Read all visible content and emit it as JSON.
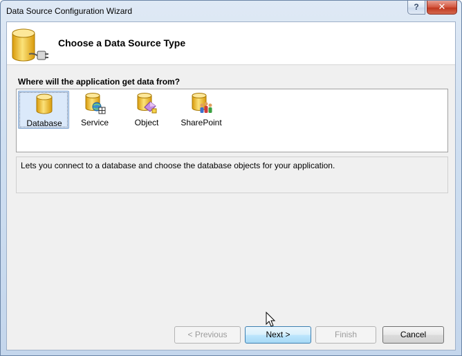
{
  "window": {
    "title": "Data Source Configuration Wizard",
    "help_label": "?",
    "close_label": "✕"
  },
  "header": {
    "title": "Choose a Data Source Type",
    "icon": "database-plug-icon"
  },
  "prompt": "Where will the application get data from?",
  "data_source_types": [
    {
      "label": "Database",
      "icon": "database-icon",
      "selected": true
    },
    {
      "label": "Service",
      "icon": "service-icon",
      "selected": false
    },
    {
      "label": "Object",
      "icon": "object-icon",
      "selected": false
    },
    {
      "label": "SharePoint",
      "icon": "sharepoint-icon",
      "selected": false
    }
  ],
  "description": "Lets you connect to a database and choose the database objects for your application.",
  "buttons": {
    "previous": "< Previous",
    "next": "Next >",
    "finish": "Finish",
    "cancel": "Cancel"
  },
  "colors": {
    "cylinder_gold": "#f0b81c",
    "selection": "#dbe9fa"
  }
}
